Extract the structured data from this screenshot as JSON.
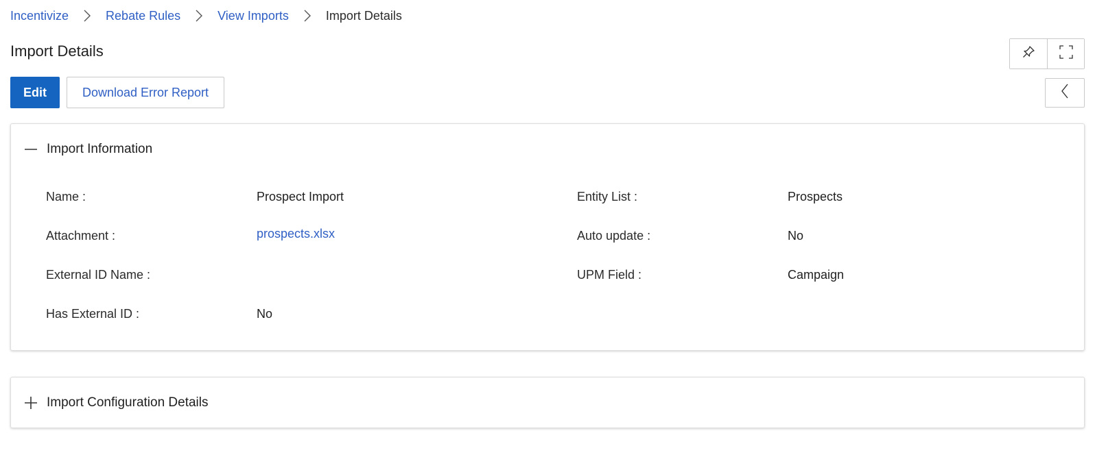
{
  "breadcrumb": {
    "items": [
      "Incentivize",
      "Rebate Rules",
      "View Imports"
    ],
    "current": "Import Details"
  },
  "header": {
    "title": "Import Details"
  },
  "actions": {
    "edit_label": "Edit",
    "download_label": "Download Error Report"
  },
  "import_information": {
    "title": "Import Information",
    "fields": {
      "name_label": "Name :",
      "name_value": "Prospect Import",
      "attachment_label": "Attachment :",
      "attachment_value": "prospects.xlsx",
      "external_id_name_label": "External ID Name :",
      "external_id_name_value": "",
      "has_external_id_label": "Has External ID :",
      "has_external_id_value": "No",
      "entity_list_label": "Entity List :",
      "entity_list_value": "Prospects",
      "auto_update_label": "Auto update :",
      "auto_update_value": "No",
      "upm_field_label": "UPM Field :",
      "upm_field_value": "Campaign"
    }
  },
  "import_configuration": {
    "title": "Import Configuration Details"
  },
  "colors": {
    "link": "#2f5fc4",
    "primary": "#1565c0"
  },
  "icons": {
    "pin": "pin-icon",
    "fullscreen": "fullscreen-icon",
    "collapse": "chevron-left-icon",
    "collapse_section": "minus-icon",
    "expand_section": "plus-icon",
    "separator": "chevron-right-icon"
  }
}
